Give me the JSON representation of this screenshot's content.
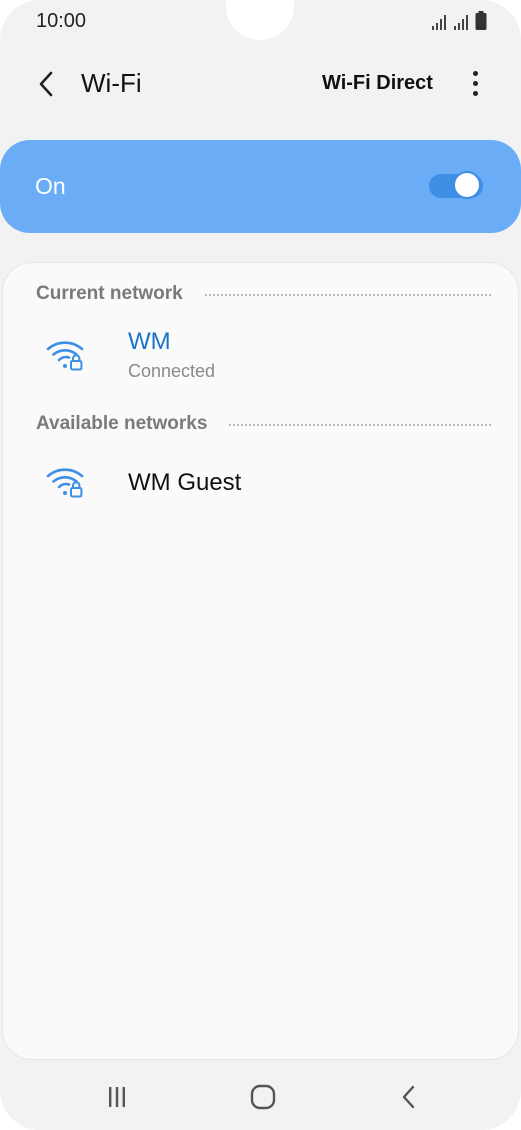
{
  "status_bar": {
    "time": "10:00",
    "icons": [
      "signal-icon",
      "signal-icon",
      "battery-icon"
    ]
  },
  "header": {
    "title": "Wi-Fi",
    "action_label": "Wi-Fi Direct",
    "back_icon": "chevron-left-icon",
    "more_icon": "more-vertical-icon"
  },
  "wifi_toggle": {
    "label": "On",
    "state": "on"
  },
  "current_network": {
    "section_title": "Current network",
    "networks": [
      {
        "name": "WM",
        "status": "Connected",
        "icon": "wifi-locked-icon"
      }
    ]
  },
  "available_networks": {
    "section_title": "Available networks",
    "networks": [
      {
        "name": "WM Guest",
        "icon": "wifi-locked-icon"
      }
    ]
  },
  "nav_bar": {
    "buttons": [
      "recent-apps-icon",
      "home-icon",
      "back-icon"
    ]
  },
  "colors": {
    "accent": "#6aacf6",
    "switch_on": "#3f8ee6",
    "connected_name": "#1a73c8",
    "wifi_icon": "#3d8fe6",
    "background": "#f2f2f2"
  }
}
